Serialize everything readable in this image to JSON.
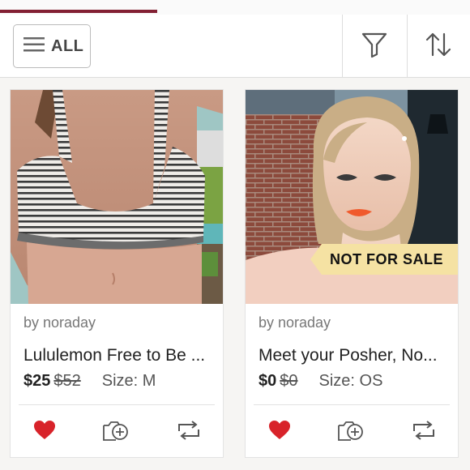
{
  "toolbar": {
    "all_label": "ALL",
    "icons": [
      "menu-icon",
      "filter-icon",
      "sort-icon"
    ]
  },
  "listings": [
    {
      "seller": "by noraday",
      "title": "Lululemon Free to Be ...",
      "price": "$25",
      "original_price": "$52",
      "size": "Size: M",
      "liked": true
    },
    {
      "seller": "by noraday",
      "title": "Meet your Posher, No...",
      "price": "$0",
      "original_price": "$0",
      "size": "Size: OS",
      "liked": true,
      "badge": "NOT FOR SALE"
    }
  ],
  "colors": {
    "brand": "#822033",
    "heart": "#d8232a",
    "badge_bg": "#f5e2a3"
  }
}
